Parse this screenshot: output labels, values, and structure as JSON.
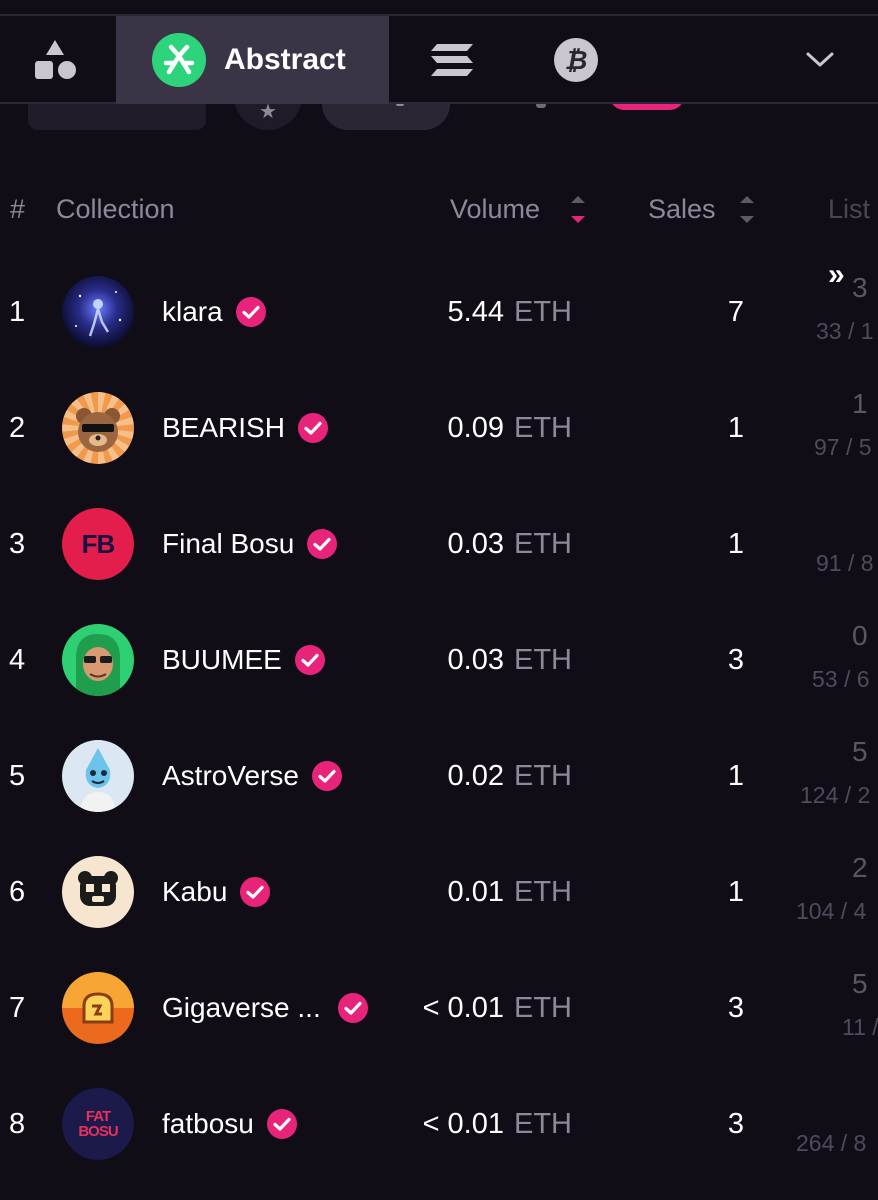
{
  "tabs": [
    {
      "id": "all",
      "label": "",
      "icon": "shapes-icon"
    },
    {
      "id": "abstract",
      "label": "Abstract",
      "icon": "abstract-logo-icon",
      "active": true
    },
    {
      "id": "solana",
      "label": "",
      "icon": "solana-logo-icon"
    },
    {
      "id": "bitcoin",
      "label": "",
      "icon": "bitcoin-logo-icon",
      "glyph": "₿"
    },
    {
      "id": "more",
      "label": "",
      "icon": "chevron-down-icon"
    }
  ],
  "table": {
    "headers": {
      "rank": "#",
      "collection": "Collection",
      "volume": "Volume",
      "sales": "Sales",
      "listed": "List"
    },
    "expand_glyph": "»",
    "rows": [
      {
        "rank": "1",
        "name": "klara",
        "volume": "5.44",
        "unit": "ETH",
        "sales": "7",
        "listed_top": "3",
        "listed_bottom": "33 / 1"
      },
      {
        "rank": "2",
        "name": "BEARISH",
        "volume": "0.09",
        "unit": "ETH",
        "sales": "1",
        "listed_top": "1",
        "listed_bottom": "97 / 5"
      },
      {
        "rank": "3",
        "name": "Final Bosu",
        "volume": "0.03",
        "unit": "ETH",
        "sales": "1",
        "listed_top": "",
        "listed_bottom": "91 / 8",
        "avatar_text": "FB"
      },
      {
        "rank": "4",
        "name": "BUUMEE",
        "volume": "0.03",
        "unit": "ETH",
        "sales": "3",
        "listed_top": "0",
        "listed_bottom": "53 / 6"
      },
      {
        "rank": "5",
        "name": "AstroVerse",
        "volume": "0.02",
        "unit": "ETH",
        "sales": "1",
        "listed_top": "5",
        "listed_bottom": "124 / 2"
      },
      {
        "rank": "6",
        "name": "Kabu",
        "volume": "0.01",
        "unit": "ETH",
        "sales": "1",
        "listed_top": "2",
        "listed_bottom": "104 / 4"
      },
      {
        "rank": "7",
        "name": "Gigaverse ...",
        "volume": "< 0.01",
        "unit": "ETH",
        "sales": "3",
        "listed_top": "5",
        "listed_bottom": "11 /"
      },
      {
        "rank": "8",
        "name": "fatbosu",
        "volume": "< 0.01",
        "unit": "ETH",
        "sales": "3",
        "listed_top": "",
        "listed_bottom": "264 / 8",
        "avatar_text": "FAT BOSU"
      }
    ]
  },
  "colors": {
    "background": "#100d17",
    "accent_pink": "#e8247a",
    "abstract_green": "#2ed47c",
    "active_tab": "#3a3446",
    "muted_text": "#8d889a"
  }
}
